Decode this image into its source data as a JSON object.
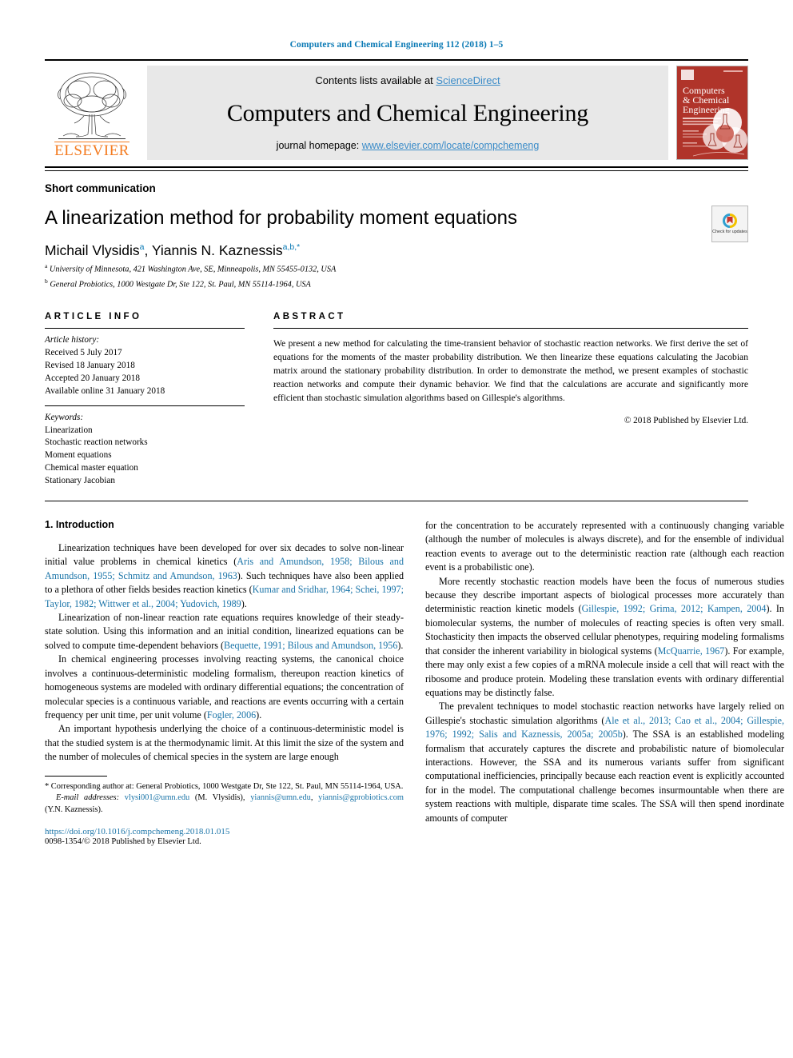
{
  "running_head": "Computers and Chemical Engineering 112 (2018) 1–5",
  "masthead": {
    "publisher_name": "ELSEVIER",
    "contents_prefix": "Contents lists available at ",
    "contents_link": "ScienceDirect",
    "journal_name": "Computers and Chemical Engineering",
    "homepage_prefix": "journal homepage: ",
    "homepage_url": "www.elsevier.com/locate/compchemeng",
    "cover": {
      "line1": "Computers",
      "line2": "& Chemical",
      "line3": "Engineering"
    }
  },
  "article": {
    "category": "Short communication",
    "title": "A linearization method for probability moment equations",
    "authors_html": "Michail Vlysidis<sup>a</sup>, Yiannis N. Kaznessis<sup>a,b,</sup><sup>*</sup>",
    "affiliation_a": "University of Minnesota, 421 Washington Ave, SE, Minneapolis, MN 55455-0132, USA",
    "affiliation_b": "General Probiotics, 1000 Westgate Dr, Ste 122, St. Paul, MN 55114-1964, USA",
    "crossmark_label": "Check for updates"
  },
  "article_info": {
    "heading": "ARTICLE INFO",
    "history_label": "Article history:",
    "history": [
      "Received 5 July 2017",
      "Revised 18 January 2018",
      "Accepted 20 January 2018",
      "Available online 31 January 2018"
    ],
    "keywords_label": "Keywords:",
    "keywords": [
      "Linearization",
      "Stochastic reaction networks",
      "Moment equations",
      "Chemical master equation",
      "Stationary Jacobian"
    ]
  },
  "abstract": {
    "heading": "ABSTRACT",
    "text": "We present a new method for calculating the time-transient behavior of stochastic reaction networks. We first derive the set of equations for the moments of the master probability distribution. We then linearize these equations calculating the Jacobian matrix around the stationary probability distribution. In order to demonstrate the method, we present examples of stochastic reaction networks and compute their dynamic behavior. We find that the calculations are accurate and significantly more efficient than stochastic simulation algorithms based on Gillespie's algorithms.",
    "copyright": "© 2018 Published by Elsevier Ltd."
  },
  "body": {
    "section1_heading": "1. Introduction",
    "left_paragraphs": [
      "Linearization techniques have been developed for over six decades to solve non-linear initial value problems in chemical kinetics (<span class=\"cite\">Aris and Amundson, 1958; Bilous and Amundson, 1955; Schmitz and Amundson, 1963</span>). Such techniques have also been applied to a plethora of other fields besides reaction kinetics (<span class=\"cite\">Kumar and Sridhar, 1964; Schei, 1997; Taylor, 1982; Wittwer et al., 2004; Yudovich, 1989</span>).",
      "Linearization of non-linear reaction rate equations requires knowledge of their steady-state solution. Using this information and an initial condition, linearized equations can be solved to compute time-dependent behaviors (<span class=\"cite\">Bequette, 1991; Bilous and Amundson, 1956</span>).",
      "In chemical engineering processes involving reacting systems, the canonical choice involves a continuous-deterministic modeling formalism, thereupon reaction kinetics of homogeneous systems are modeled with ordinary differential equations; the concentration of molecular species is a continuous variable, and reactions are events occurring with a certain frequency per unit time, per unit volume (<span class=\"cite\">Fogler, 2006</span>).",
      "An important hypothesis underlying the choice of a continuous-deterministic model is that the studied system is at the thermodynamic limit. At this limit the size of the system and the number of molecules of chemical species in the system are large enough"
    ],
    "right_paragraphs": [
      "for the concentration to be accurately represented with a continuously changing variable (although the number of molecules is always discrete), and for the ensemble of individual reaction events to average out to the deterministic reaction rate (although each reaction event is a probabilistic one).",
      "More recently stochastic reaction models have been the focus of numerous studies because they describe important aspects of biological processes more accurately than deterministic reaction kinetic models (<span class=\"cite\">Gillespie, 1992; Grima, 2012; Kampen, 2004</span>). In biomolecular systems, the number of molecules of reacting species is often very small. Stochasticity then impacts the observed cellular phenotypes, requiring modeling formalisms that consider the inherent variability in biological systems (<span class=\"cite\">McQuarrie, 1967</span>). For example, there may only exist a few copies of a mRNA molecule inside a cell that will react with the ribosome and produce protein. Modeling these translation events with ordinary differential equations may be distinctly false.",
      "The prevalent techniques to model stochastic reaction networks have largely relied on Gillespie's stochastic simulation algorithms (<span class=\"cite\">Ale et al., 2013; Cao et al., 2004; Gillespie, 1976; 1992; Salis and Kaznessis, 2005a; 2005b</span>). The SSA is an established modeling formalism that accurately captures the discrete and probabilistic nature of biomolecular interactions. However, the SSA and its numerous variants suffer from significant computational inefficiencies, principally because each reaction event is explicitly accounted for in the model. The computational challenge becomes insurmountable when there are system reactions with multiple, disparate time scales. The SSA will then spend inordinate amounts of computer"
    ]
  },
  "footnotes": {
    "corresponding": "* Corresponding author at: General Probiotics, 1000 Westgate Dr, Ste 122, St. Paul, MN 55114-1964, USA.",
    "emails_html": "<span class=\"ital\">E-mail addresses:</span> <span class=\"cite\">vlysi001@umn.edu</span> (M. Vlysidis), <span class=\"cite\">yiannis@umn.edu</span>, <span class=\"cite\">yiannis@gprobiotics.com</span> (Y.N. Kaznessis).",
    "doi": "https://doi.org/10.1016/j.compchemeng.2018.01.015",
    "issn": "0098-1354/© 2018 Published by Elsevier Ltd."
  },
  "colors": {
    "link_blue": "#1a74a8",
    "header_blue": "#0b7ab5",
    "elsevier_orange": "#F47B20",
    "cover_red": "#b0342a",
    "masthead_gray": "#e8e8e8"
  }
}
